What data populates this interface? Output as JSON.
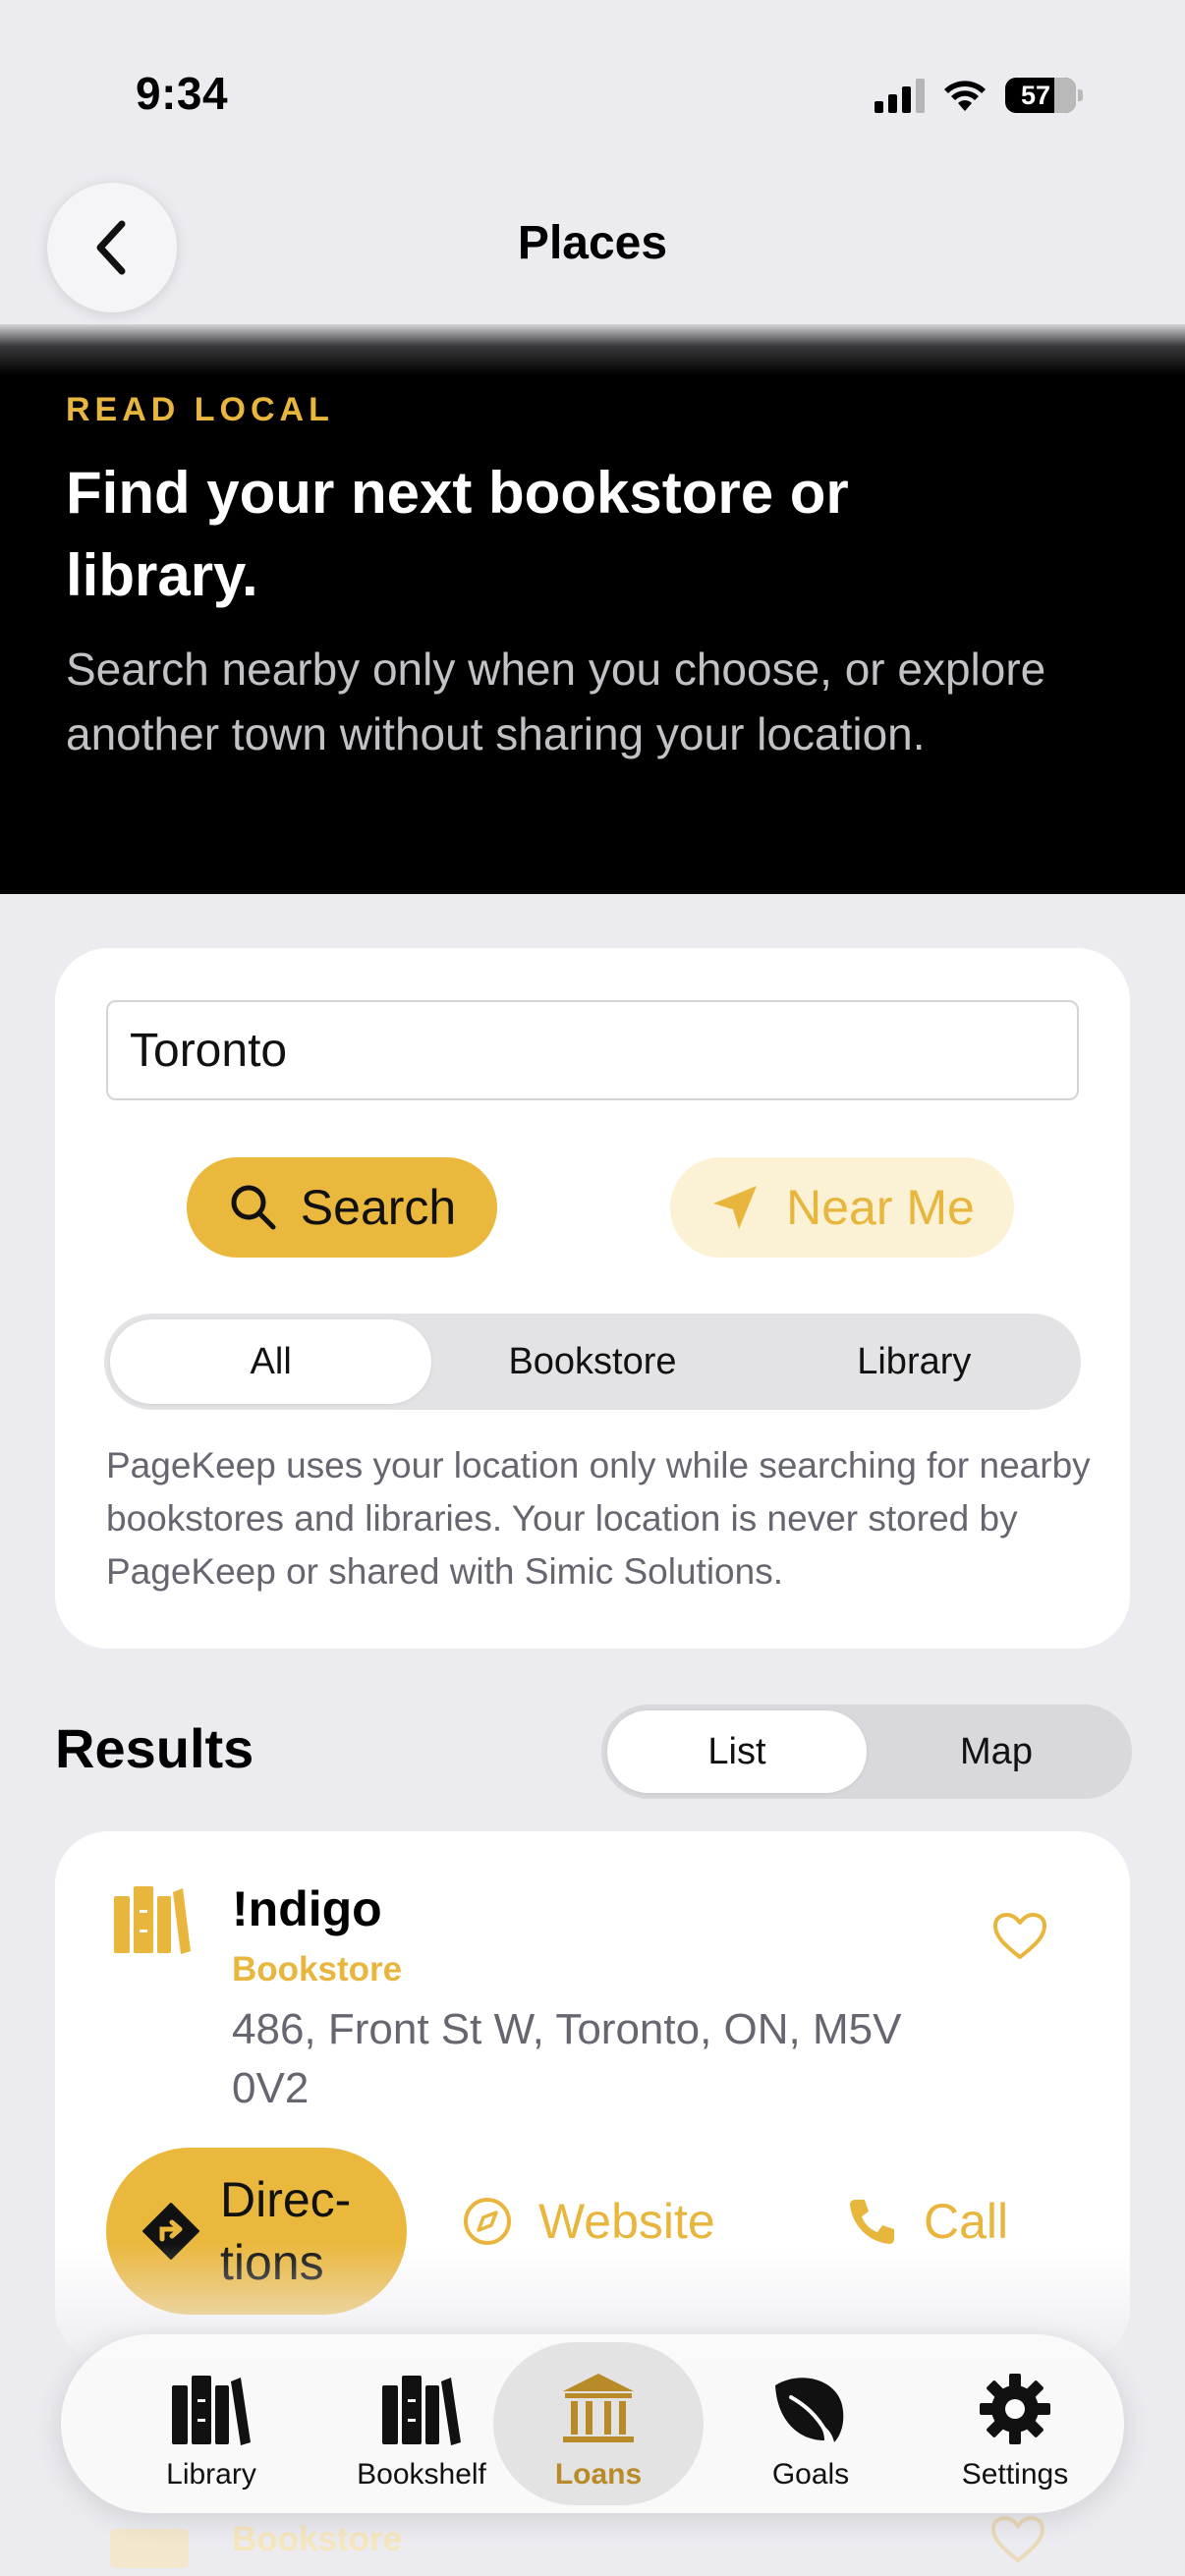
{
  "status_bar": {
    "time": "9:34",
    "battery": "57"
  },
  "nav": {
    "title": "Places"
  },
  "hero": {
    "eyebrow": "READ LOCAL",
    "title": "Find your next bookstore or library.",
    "subtitle": "Search nearby only when you choose, or explore another town without sharing your location."
  },
  "search": {
    "value": "Toronto",
    "search_label": "Search",
    "near_me_label": "Near Me",
    "filters": [
      {
        "label": "All",
        "selected": true
      },
      {
        "label": "Bookstore",
        "selected": false
      },
      {
        "label": "Library",
        "selected": false
      }
    ],
    "privacy_note": "PageKeep uses your location only while searching for nearby bookstores and libraries. Your location is never stored by PageKeep or shared with Simic Solutions."
  },
  "results": {
    "title": "Results",
    "views": [
      {
        "label": "List",
        "selected": true
      },
      {
        "label": "Map",
        "selected": false
      }
    ],
    "items": [
      {
        "name": "!ndigo",
        "type": "Bookstore",
        "address": "486, Front St W, Toronto, ON, M5V 0V2",
        "icon": "books-icon",
        "actions": {
          "directions": "Direc-tions",
          "website": "Website",
          "call": "Call"
        }
      },
      {
        "type": "Bookstore"
      }
    ]
  },
  "tab_bar": [
    {
      "label": "Library",
      "icon": "library-icon",
      "active": false
    },
    {
      "label": "Bookshelf",
      "icon": "bookshelf-icon",
      "active": false
    },
    {
      "label": "Loans",
      "icon": "bank-icon",
      "active": true
    },
    {
      "label": "Goals",
      "icon": "leaf-icon",
      "active": false
    },
    {
      "label": "Settings",
      "icon": "gear-icon",
      "active": false
    }
  ],
  "colors": {
    "accent": "#ebb83e",
    "accent_text": "#e8b63d",
    "accent_light": "#fbf1d4",
    "background": "#ebebf0"
  }
}
